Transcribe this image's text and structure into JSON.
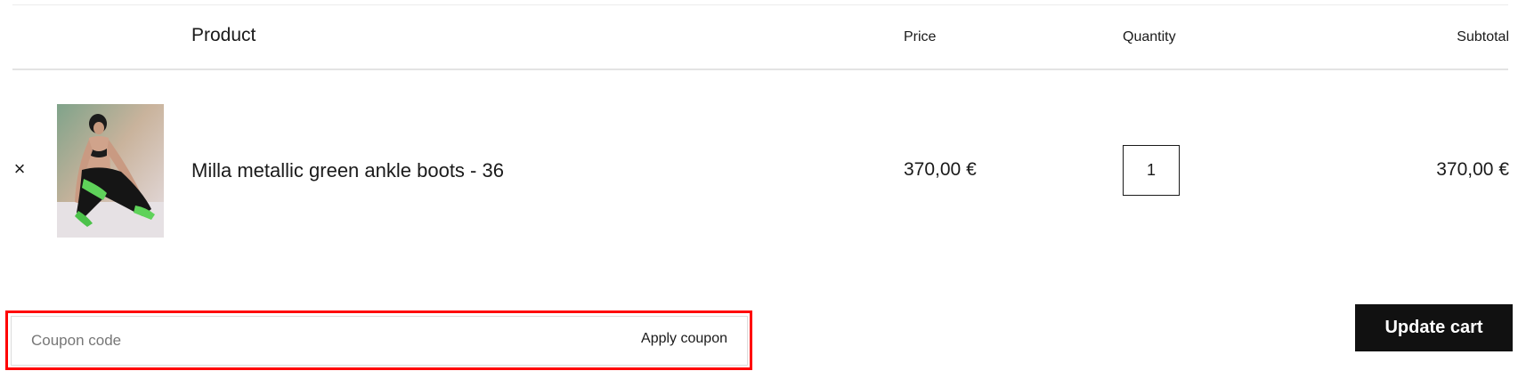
{
  "table": {
    "headers": {
      "product": "Product",
      "price": "Price",
      "quantity": "Quantity",
      "subtotal": "Subtotal"
    },
    "rows": [
      {
        "remove_label": "×",
        "image_icon": "product-photo-model-green-boots",
        "name": "Milla metallic green ankle boots - 36",
        "price": "370,00 €",
        "quantity": "1",
        "subtotal": "370,00 €"
      }
    ]
  },
  "coupon": {
    "placeholder": "Coupon code",
    "value": "",
    "apply_label": "Apply coupon",
    "highlight_color": "#ff0000"
  },
  "actions": {
    "update_cart_label": "Update cart",
    "update_cart_bg": "#111111"
  }
}
